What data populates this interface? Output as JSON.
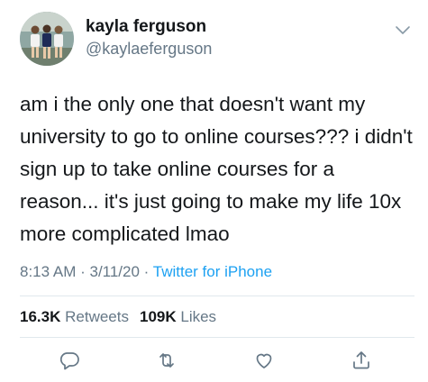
{
  "author": {
    "name": "kayla ferguson",
    "handle": "@kaylaeferguson",
    "avatar_icon": "profile-photo-group-of-friends"
  },
  "tweet": {
    "text": "am i the only one that doesn't want my university to go to online courses??? i didn't sign up to take online courses for a reason... it's just going to make my life 10x more complicated lmao",
    "time": "8:13 AM",
    "separator": " · ",
    "date": "3/11/20",
    "source": "Twitter for iPhone"
  },
  "stats": {
    "retweets_count": "16.3K",
    "retweets_label": "Retweets",
    "likes_count": "109K",
    "likes_label": "Likes"
  },
  "actions": [
    {
      "icon": "reply-icon"
    },
    {
      "icon": "retweet-icon"
    },
    {
      "icon": "like-heart-icon"
    },
    {
      "icon": "share-icon"
    }
  ],
  "colors": {
    "text": "#14171a",
    "secondary": "#657786",
    "link": "#1da1f2",
    "divider": "#e1e8ed"
  }
}
